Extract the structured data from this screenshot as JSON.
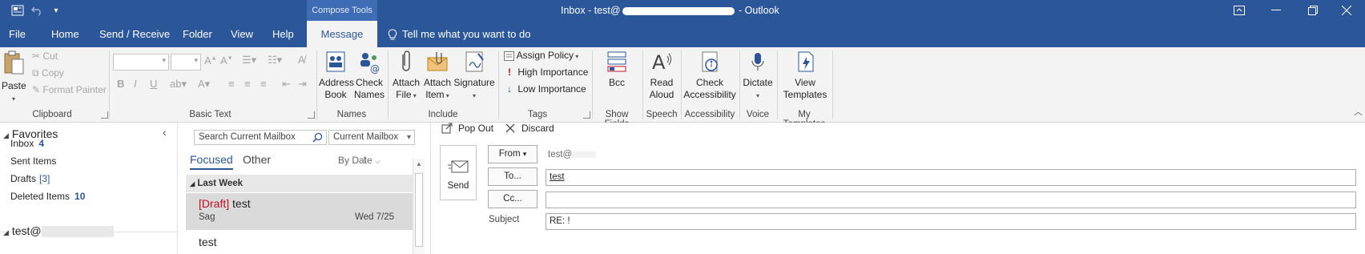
{
  "titlebar": {
    "window_title_prefix": "Inbox - test@",
    "window_title_suffix": "- Outlook",
    "contextual_tab": "Compose Tools"
  },
  "tabs": {
    "file": "File",
    "home": "Home",
    "send_receive": "Send / Receive",
    "folder": "Folder",
    "view": "View",
    "help": "Help",
    "message": "Message",
    "tell_me": "Tell me what you want to do"
  },
  "ribbon": {
    "clipboard": {
      "paste": "Paste",
      "cut": "Cut",
      "copy": "Copy",
      "format_painter": "Format Painter",
      "label": "Clipboard"
    },
    "basic_text": {
      "label": "Basic Text"
    },
    "names": {
      "address_book": [
        "Address",
        "Book"
      ],
      "check_names": [
        "Check",
        "Names"
      ],
      "label": "Names"
    },
    "include": {
      "attach_file": [
        "Attach",
        "File"
      ],
      "attach_item": [
        "Attach",
        "Item"
      ],
      "signature": "Signature",
      "label": "Include"
    },
    "tags": {
      "assign_policy": "Assign Policy",
      "high_importance": "High Importance",
      "low_importance": "Low Importance",
      "label": "Tags"
    },
    "show_fields": {
      "bcc": "Bcc",
      "label": "Show Fields"
    },
    "speech": {
      "read_aloud": [
        "Read",
        "Aloud"
      ],
      "label": "Speech"
    },
    "accessibility": {
      "check_accessibility": [
        "Check",
        "Accessibility"
      ],
      "label": "Accessibility"
    },
    "voice": {
      "dictate": "Dictate",
      "label": "Voice"
    },
    "my_templates": {
      "view_templates": [
        "View",
        "Templates"
      ],
      "label": "My Templates"
    }
  },
  "folders": {
    "favorites": "Favorites",
    "items": [
      {
        "name": "Inbox",
        "count": "4"
      },
      {
        "name": "Sent Items",
        "count": ""
      },
      {
        "name": "Drafts",
        "count": "[3]"
      },
      {
        "name": "Deleted Items",
        "count": "10"
      }
    ],
    "account_prefix": "test@"
  },
  "messagelist": {
    "search_placeholder": "Search Current Mailbox",
    "scope": "Current Mailbox",
    "tab_focused": "Focused",
    "tab_other": "Other",
    "sort": "By Date",
    "group": "Last Week",
    "messages": [
      {
        "draft_tag": "[Draft]",
        "subject": "test",
        "from": "Sag",
        "date": "Wed 7/25"
      },
      {
        "draft_tag": "",
        "subject": "test",
        "from": "",
        "date": ""
      }
    ]
  },
  "compose": {
    "pop_out": "Pop Out",
    "discard": "Discard",
    "send": "Send",
    "from_btn": "From",
    "from_value": "test@",
    "to_btn": "To...",
    "to_value": "test",
    "cc_btn": "Cc...",
    "cc_value": "",
    "subject_label": "Subject",
    "subject_value": "RE: !"
  }
}
